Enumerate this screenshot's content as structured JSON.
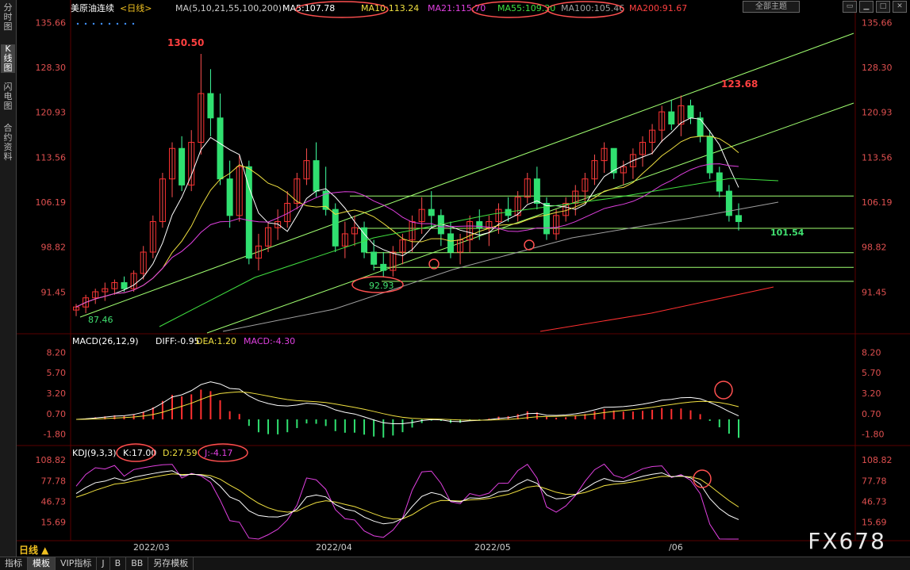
{
  "sidebar_tabs": [
    {
      "label": "分时图",
      "active": false
    },
    {
      "label": "K线图",
      "active": true
    },
    {
      "label": "闪电图",
      "active": false
    },
    {
      "label": "合约资料",
      "active": false
    }
  ],
  "header": {
    "instrument": "美原油连续",
    "period": "<日线>",
    "ma_params": "MA(5,10,21,55,100,200)",
    "ma": [
      {
        "label": "MA5:107.78",
        "color": "#ffffff"
      },
      {
        "label": "MA10:113.24",
        "color": "#f0e040"
      },
      {
        "label": "MA21:115.70",
        "color": "#e040e0"
      },
      {
        "label": "MA55:109.30",
        "color": "#40e040"
      },
      {
        "label": "MA100:105.46",
        "color": "#a0a0a0"
      },
      {
        "label": "MA200:91.67",
        "color": "#ff4040"
      }
    ],
    "theme_button": "全部主题"
  },
  "price_axis": [
    "135.66",
    "128.30",
    "120.93",
    "113.56",
    "106.19",
    "98.82",
    "91.45"
  ],
  "annotations": {
    "high1": "130.50",
    "high2": "123.68",
    "low1": "87.46",
    "low2": "92.93",
    "last_low": "101.54"
  },
  "macd": {
    "params": "MACD(26,12,9)",
    "diff": "DIFF:-0.95",
    "dea": "DEA:1.20",
    "macd": "MACD:-4.30",
    "axis": [
      "8.20",
      "5.70",
      "3.20",
      "0.70",
      "-1.80"
    ]
  },
  "kdj": {
    "params": "KDJ(9,3,3)",
    "k": "K:17.00",
    "d": "D:27.59",
    "j": "J:-4.17",
    "axis": [
      "108.82",
      "77.78",
      "46.73",
      "15.69"
    ]
  },
  "date_axis": [
    "2022/03",
    "2022/04",
    "2022/05",
    "/06"
  ],
  "period_button": "日线 ▲",
  "bottom_tabs": [
    {
      "label": "指标",
      "active": false
    },
    {
      "label": "模板",
      "active": true
    },
    {
      "label": "VIP指标",
      "active": false
    },
    {
      "label": "J",
      "active": false
    },
    {
      "label": "B",
      "active": false
    },
    {
      "label": "BB",
      "active": false
    },
    {
      "label": "另存模板",
      "active": false
    }
  ],
  "watermark": "FX678",
  "chart_data": [
    {
      "type": "candlestick",
      "title": "美原油连续 <日线>",
      "ylim": [
        85,
        137
      ],
      "x_labels": [
        "2022/03",
        "2022/04",
        "2022/05",
        "/06"
      ],
      "series": [
        {
          "name": "MA5",
          "last": 107.78
        },
        {
          "name": "MA10",
          "last": 113.24
        },
        {
          "name": "MA21",
          "last": 115.7
        },
        {
          "name": "MA55",
          "last": 109.3
        },
        {
          "name": "MA100",
          "last": 105.46
        },
        {
          "name": "MA200",
          "last": 91.67
        }
      ],
      "candles": [
        [
          88.5,
          89.5,
          87.5,
          89
        ],
        [
          89,
          91,
          88,
          90.5
        ],
        [
          90.5,
          92,
          89.5,
          91.5
        ],
        [
          91.5,
          93,
          90,
          92
        ],
        [
          92,
          93.5,
          91,
          93
        ],
        [
          93,
          94,
          91.5,
          92
        ],
        [
          92,
          95,
          91.5,
          94.5
        ],
        [
          94.5,
          99,
          93.5,
          98
        ],
        [
          98,
          104,
          97,
          103
        ],
        [
          103,
          111,
          102,
          110
        ],
        [
          110,
          116,
          107,
          115
        ],
        [
          115,
          117,
          108,
          109
        ],
        [
          109,
          118,
          108,
          116
        ],
        [
          116,
          130.5,
          114,
          124
        ],
        [
          124,
          128,
          117,
          120
        ],
        [
          120,
          124,
          109,
          110
        ],
        [
          110,
          113,
          102,
          104
        ],
        [
          104,
          114,
          103,
          112
        ],
        [
          112,
          113,
          96,
          97
        ],
        [
          97,
          101,
          95,
          99
        ],
        [
          99,
          103,
          98,
          102
        ],
        [
          102,
          105,
          100,
          103
        ],
        [
          103,
          108,
          102,
          106
        ],
        [
          106,
          111,
          105,
          110
        ],
        [
          110,
          115,
          109,
          113
        ],
        [
          113,
          116,
          107,
          108
        ],
        [
          108,
          112,
          104,
          105
        ],
        [
          105,
          106,
          98,
          99
        ],
        [
          99,
          103,
          97,
          101
        ],
        [
          101,
          104,
          99,
          102
        ],
        [
          102,
          103,
          97,
          98
        ],
        [
          98,
          100,
          95,
          96
        ],
        [
          96,
          98,
          94,
          95
        ],
        [
          95,
          99,
          94,
          98
        ],
        [
          98,
          101,
          96,
          100
        ],
        [
          100,
          104,
          98,
          103
        ],
        [
          103,
          107,
          101,
          105
        ],
        [
          105,
          108,
          102,
          104
        ],
        [
          104,
          105,
          99,
          101
        ],
        [
          101,
          103,
          97,
          98
        ],
        [
          98,
          101,
          96,
          100
        ],
        [
          100,
          104,
          98,
          103
        ],
        [
          103,
          105,
          100,
          102
        ],
        [
          102,
          104,
          99,
          103
        ],
        [
          103,
          106,
          101,
          105
        ],
        [
          105,
          107,
          103,
          104
        ],
        [
          104,
          108,
          103,
          107
        ],
        [
          107,
          111,
          106,
          110
        ],
        [
          110,
          112,
          105,
          106
        ],
        [
          106,
          107,
          100,
          101
        ],
        [
          101,
          105,
          100,
          104
        ],
        [
          104,
          107,
          103,
          106
        ],
        [
          106,
          109,
          104,
          108
        ],
        [
          108,
          111,
          106,
          110
        ],
        [
          110,
          114,
          109,
          113
        ],
        [
          113,
          116,
          111,
          115
        ],
        [
          115,
          114,
          110,
          111
        ],
        [
          111,
          113,
          109,
          112
        ],
        [
          112,
          115,
          110,
          114
        ],
        [
          114,
          117,
          112,
          116
        ],
        [
          116,
          119,
          114,
          118
        ],
        [
          118,
          122,
          116,
          121
        ],
        [
          121,
          123,
          118,
          119
        ],
        [
          119,
          123.68,
          117,
          122
        ],
        [
          122,
          123,
          119,
          120
        ],
        [
          120,
          121,
          116,
          117
        ],
        [
          117,
          118,
          110,
          111
        ],
        [
          111,
          112,
          107,
          108
        ],
        [
          108,
          109,
          103,
          104
        ],
        [
          104,
          106,
          101.54,
          103
        ]
      ],
      "macd": {
        "diff_last": -0.95,
        "dea_last": 1.2,
        "macd_last": -4.3,
        "ylim": [
          -3,
          9
        ]
      },
      "kdj": {
        "k_last": 17.0,
        "d_last": 27.59,
        "j_last": -4.17,
        "ylim": [
          -10,
          115
        ]
      }
    }
  ]
}
